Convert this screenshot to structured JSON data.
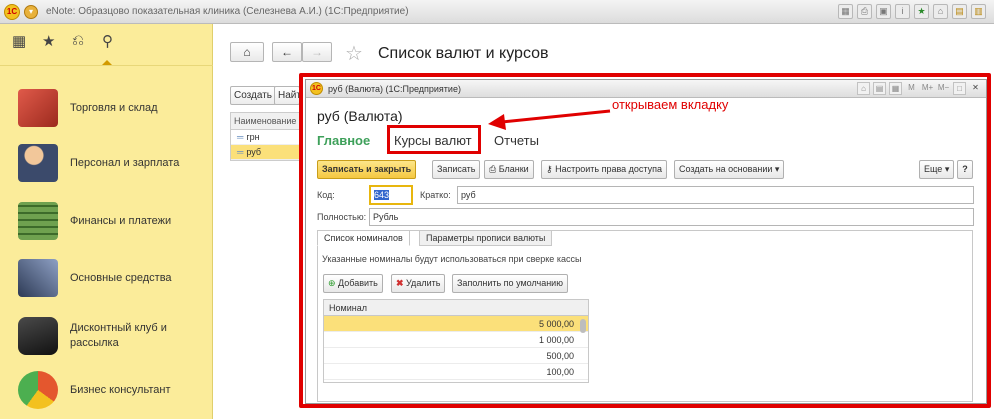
{
  "window": {
    "title": "eNote: Образцово показательная клиника (Селезнева А.И.) (1С:Предприятие)"
  },
  "sidebar": {
    "items": [
      {
        "label": "Торговля и склад",
        "icon": "warehouse-icon",
        "color": "#c0392b"
      },
      {
        "label": "Персонал и зарплата",
        "icon": "people-icon",
        "color": "#d98c3a"
      },
      {
        "label": "Финансы и платежи",
        "icon": "money-icon",
        "color": "#4f8a3a"
      },
      {
        "label": "Основные средства",
        "icon": "tools-icon",
        "color": "#5a6b8c"
      },
      {
        "label": "Дисконтный клуб и рассылка",
        "icon": "wallet-icon",
        "color": "#2b2b2b"
      },
      {
        "label": "Бизнес консультант",
        "icon": "chart-icon",
        "color": "#e4572e"
      }
    ]
  },
  "main": {
    "title": "Список валют и курсов",
    "list": {
      "create": "Создать",
      "find": "Найти",
      "column": "Наименование",
      "rows": [
        "грн",
        "руб"
      ]
    }
  },
  "dialog": {
    "bar_title": "руб (Валюта)  (1С:Предприятие)",
    "bar_icons": [
      "M",
      "M+",
      "M−"
    ],
    "title": "руб (Валюта)",
    "tabs": [
      "Главное",
      "Курсы валют",
      "Отчеты"
    ],
    "toolbar": {
      "save_close": "Записать и закрыть",
      "save": "Записать",
      "forms": "Бланки",
      "access": "Настроить права доступа",
      "create_based": "Создать на основании",
      "more": "Еще",
      "help": "?"
    },
    "fields": {
      "code_label": "Код:",
      "code_value": "643",
      "short_label": "Кратко:",
      "short_value": "руб",
      "full_label": "Полностью:",
      "full_value": "Рубль"
    },
    "subtabs": [
      "Список номиналов",
      "Параметры прописи валюты"
    ],
    "hint": "Указанные номиналы будут использоваться при сверке кассы",
    "actions": {
      "add": "Добавить",
      "remove": "Удалить",
      "fill": "Заполнить по умолчанию"
    },
    "grid": {
      "column": "Номинал",
      "rows": [
        "5 000,00",
        "1 000,00",
        "500,00",
        "100,00"
      ]
    }
  },
  "annotation": {
    "text": "открываем вкладку",
    "color": "#e00000"
  }
}
